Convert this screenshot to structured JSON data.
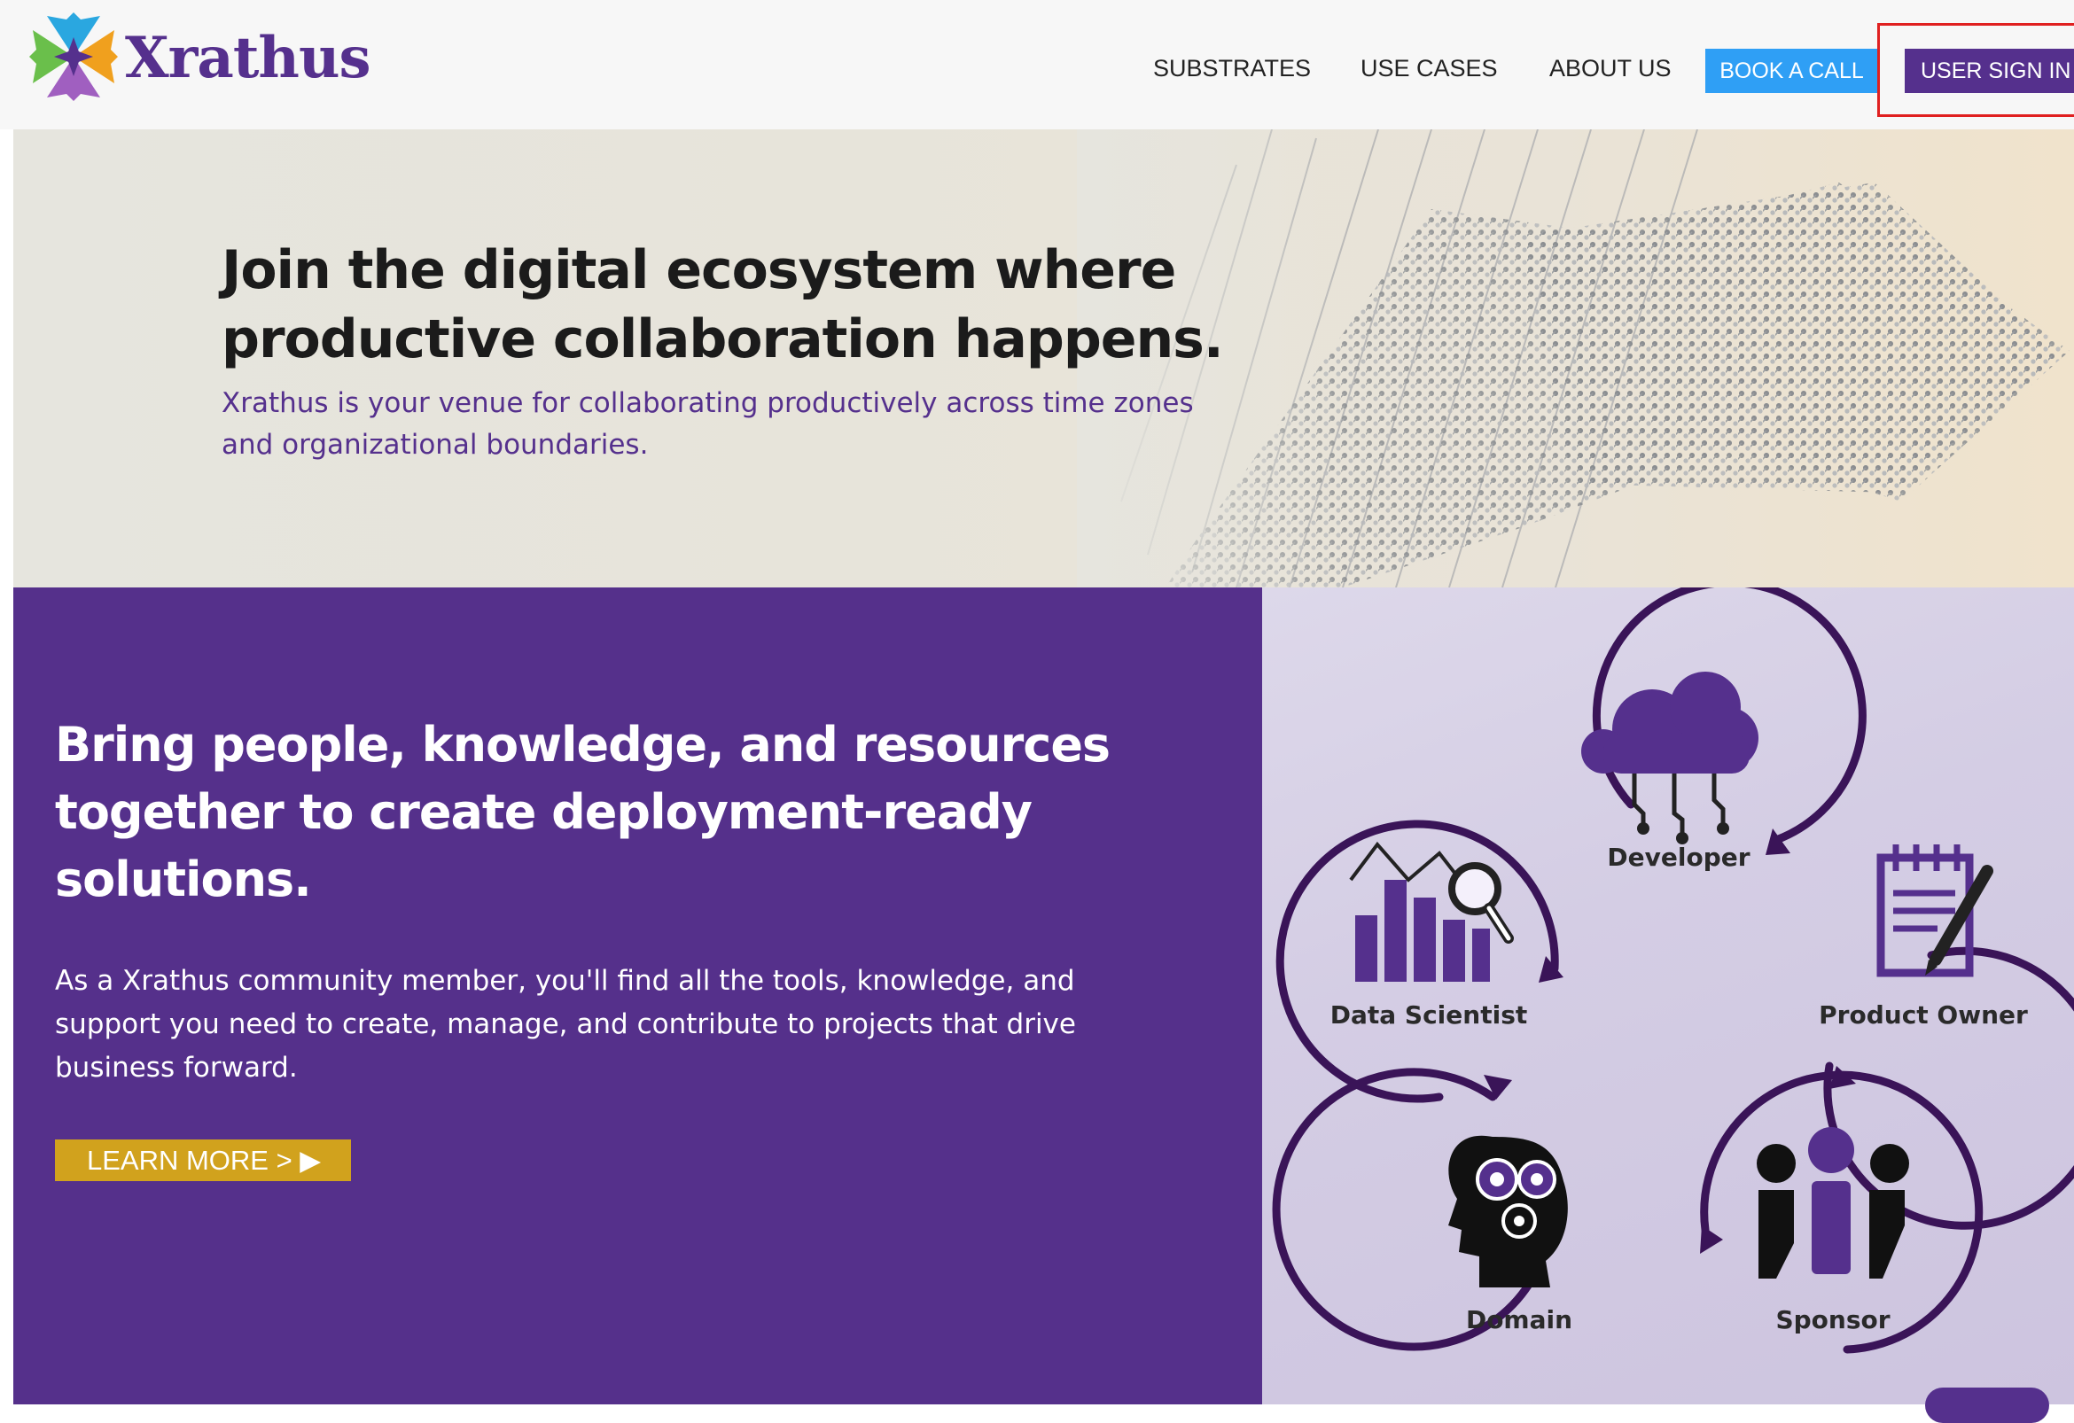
{
  "brand": {
    "name": "Xrathus",
    "logo_colors": [
      "#2aa7e0",
      "#f0a01e",
      "#6abf4b",
      "#a05fc0",
      "#55308d"
    ]
  },
  "nav": {
    "items": [
      "SUBSTRATES",
      "USE CASES",
      "ABOUT US"
    ],
    "book_call": "BOOK A CALL",
    "sign_in": "USER SIGN IN"
  },
  "hero": {
    "title": "Join the digital ecosystem where productive collaboration happens.",
    "subtitle": "Xrathus is your venue for collaborating productively across time zones and organizational boundaries."
  },
  "section": {
    "title": "Bring people, knowledge, and resources together to create deployment-ready solutions.",
    "body": "As a Xrathus community member, you'll find all the tools, knowledge, and support you need to create, manage, and contribute to projects that drive business forward.",
    "cta": "LEARN MORE > ▶"
  },
  "roles": {
    "developer": "Developer",
    "data_scientist": "Data Scientist",
    "product_owner": "Product Owner",
    "domain": "Domain",
    "sponsor": "Sponsor"
  },
  "colors": {
    "purple": "#55308b",
    "blue": "#2f9ff5",
    "gold": "#d1a21d",
    "dark_purple": "#3a1458"
  }
}
